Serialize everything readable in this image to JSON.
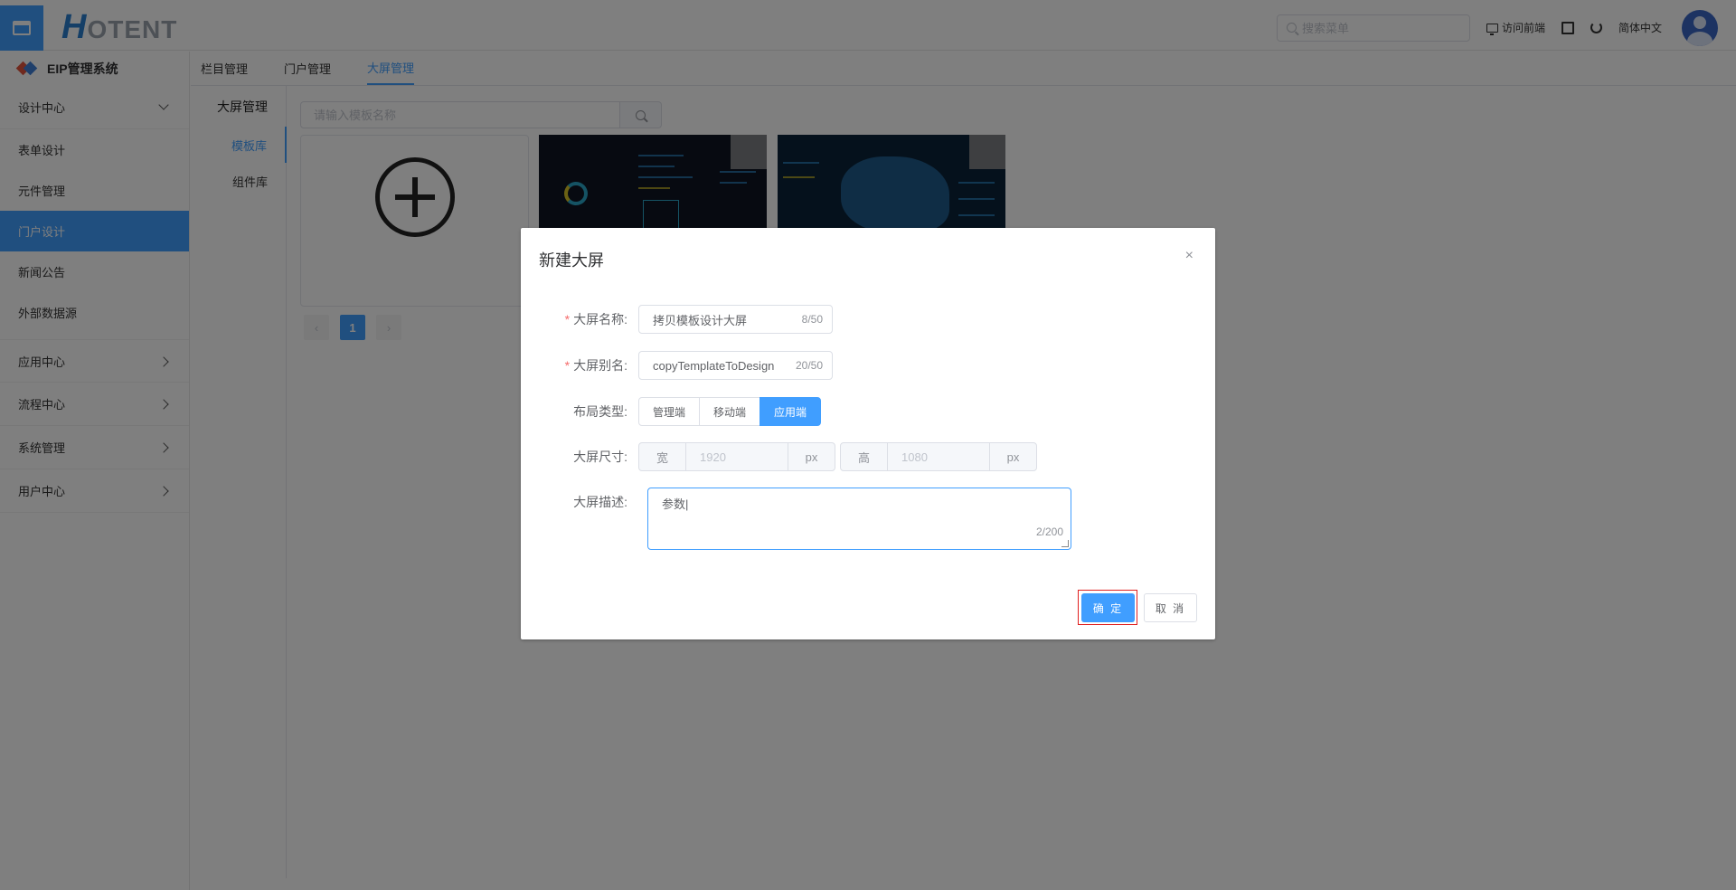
{
  "header": {
    "logo_first": "H",
    "logo_rest": "OTENT",
    "search_placeholder": "搜索菜单",
    "visit_front": "访问前端",
    "language": "简体中文"
  },
  "sidebar": {
    "brand": "EIP管理系统",
    "group_design": "设计中心",
    "items": [
      "表单设计",
      "元件管理",
      "门户设计",
      "新闻公告",
      "外部数据源"
    ],
    "active_item": "门户设计",
    "groups_collapsed": [
      "应用中心",
      "流程中心",
      "系统管理",
      "用户中心"
    ]
  },
  "tabs": [
    "栏目管理",
    "门户管理",
    "大屏管理"
  ],
  "active_tab": "大屏管理",
  "subnav": {
    "title": "大屏管理",
    "items": [
      "模板库",
      "组件库"
    ],
    "active": "模板库"
  },
  "template_search": {
    "placeholder": "请输入模板名称"
  },
  "pager": {
    "prev": "‹",
    "current": "1",
    "next": "›"
  },
  "dialog": {
    "title": "新建大屏",
    "close": "×",
    "fields": {
      "name": {
        "label": "大屏名称:",
        "value": "拷贝模板设计大屏",
        "count": "8/50"
      },
      "alias": {
        "label": "大屏别名:",
        "value": "copyTemplateToDesign",
        "count": "20/50"
      },
      "layout": {
        "label": "布局类型:",
        "options": [
          "管理端",
          "移动端",
          "应用端"
        ],
        "selected": "应用端"
      },
      "size": {
        "label": "大屏尺寸:",
        "width_prefix": "宽",
        "width": "1920",
        "height_prefix": "高",
        "height": "1080",
        "unit": "px"
      },
      "desc": {
        "label": "大屏描述:",
        "value": "参数|",
        "count": "2/200"
      }
    },
    "ok": "确 定",
    "cancel": "取 消"
  }
}
